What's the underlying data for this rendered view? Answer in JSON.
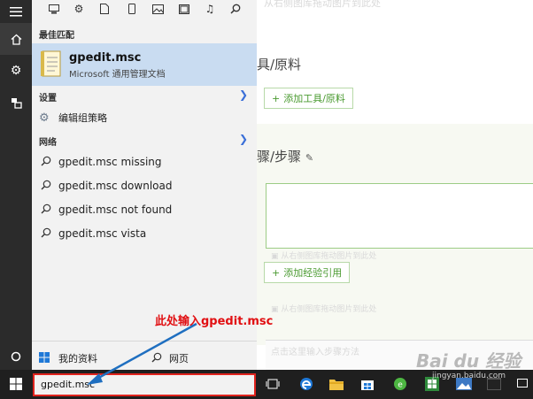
{
  "background": {
    "top_faint_text": "从右侧图库拖动图片到此处",
    "section1_title": "具/原料",
    "add_tool_btn": "添加工具/原料",
    "section2_title": "骤/步骤",
    "drop_hint": "从右侧图库拖动图片到此处",
    "add_exp_btn": "添加经验引用",
    "drop_hint2": "从右侧图库拖动图片到此处",
    "bottom_placeholder": "点击这里输入步骤方法"
  },
  "search_panel": {
    "best_match_label": "最佳匹配",
    "best_match_title": "gpedit.msc",
    "best_match_subtitle": "Microsoft 通用管理文档",
    "settings_label": "设置",
    "settings_item": "编辑组策略",
    "web_label": "网络",
    "web_results": [
      "gpedit.msc missing",
      "gpedit.msc download",
      "gpedit.msc not found",
      "gpedit.msc vista"
    ],
    "my_stuff": "我的资料",
    "web_button": "网页"
  },
  "taskbar": {
    "search_value": "gpedit.msc"
  },
  "annotation": {
    "text": "此处输入gpedit.msc"
  },
  "watermark": {
    "brand": "Bai du 经验",
    "url": "jingyan.baidu.com"
  },
  "colors": {
    "accent": "#3a6fd8",
    "highlight": "#c9dcf1",
    "annotation_red": "#e10f12",
    "arrow_blue": "#1f6fc0"
  }
}
